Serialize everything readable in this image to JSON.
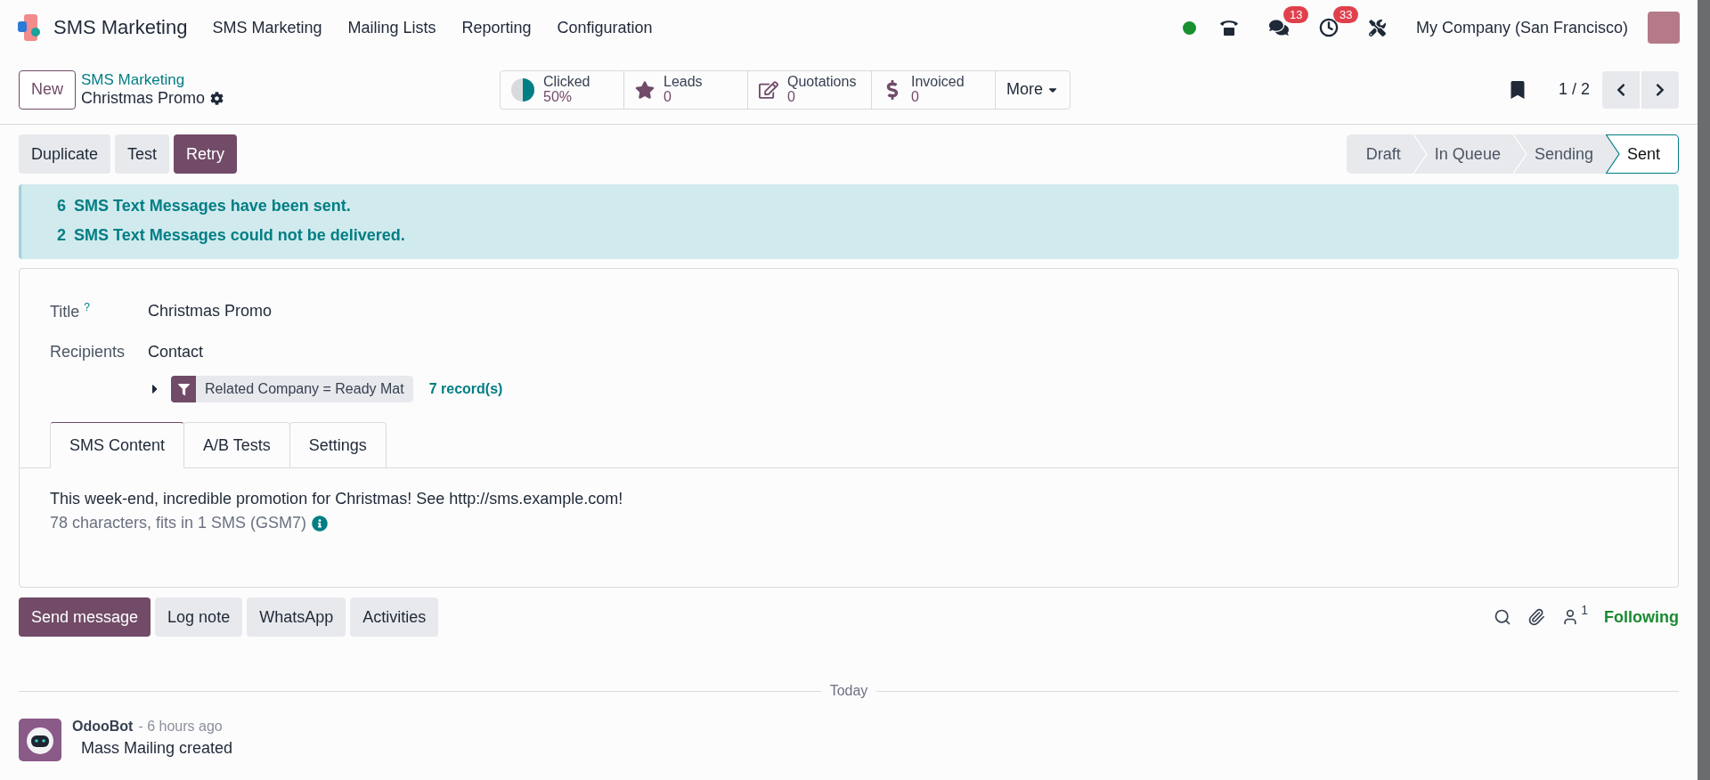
{
  "navbar": {
    "app_name": "SMS Marketing",
    "menu": [
      "SMS Marketing",
      "Mailing Lists",
      "Reporting",
      "Configuration"
    ],
    "online": true,
    "messages_count": "13",
    "activities_count": "33",
    "company": "My Company (San Francisco)"
  },
  "control_panel": {
    "new_button": "New",
    "breadcrumb": "SMS Marketing",
    "record_name": "Christmas Promo",
    "stat_buttons": [
      {
        "kind": "pie",
        "label": "Clicked",
        "value": "50%",
        "level": 0.5
      },
      {
        "kind": "star",
        "label": "Leads",
        "value": "0"
      },
      {
        "kind": "edit",
        "label": "Quotations",
        "value": "0"
      },
      {
        "kind": "dollar",
        "label": "Invoiced",
        "value": "0"
      }
    ],
    "more": "More",
    "pager": "1 / 2"
  },
  "actions": [
    {
      "label": "Duplicate",
      "primary": false
    },
    {
      "label": "Test",
      "primary": false
    },
    {
      "label": "Retry",
      "primary": true
    }
  ],
  "status_bar": [
    {
      "label": "Draft",
      "selected": false
    },
    {
      "label": "In Queue",
      "selected": false
    },
    {
      "label": "Sending",
      "selected": false
    },
    {
      "label": "Sent",
      "selected": true
    }
  ],
  "alert": [
    {
      "count": "6",
      "text": "SMS Text Messages have been sent."
    },
    {
      "count": "2",
      "text": "SMS Text Messages could not be delivered."
    }
  ],
  "form": {
    "title_label": "Title",
    "help_mark": "?",
    "title": "Christmas Promo",
    "recipients_label": "Recipients",
    "recipients": "Contact",
    "filter": "Related Company = Ready Mat",
    "records": "7 record(s)",
    "tabs": [
      {
        "label": "SMS Content",
        "selected": true
      },
      {
        "label": "A/B Tests",
        "selected": false
      },
      {
        "label": "Settings",
        "selected": false
      }
    ],
    "body": "This week-end, incredible promotion for Christmas! See http://sms.example.com!",
    "char_info": "78 characters, fits in 1 SMS (GSM7)"
  },
  "chatter": {
    "buttons": [
      {
        "label": "Send message",
        "primary": true
      },
      {
        "label": "Log note",
        "primary": false
      },
      {
        "label": "WhatsApp",
        "primary": false
      },
      {
        "label": "Activities",
        "primary": false
      }
    ],
    "followers_count": "1",
    "following": "Following",
    "divider": "Today",
    "messages": [
      {
        "author": "OdooBot",
        "time": "- 6 hours ago",
        "body": "Mass Mailing created"
      }
    ]
  }
}
